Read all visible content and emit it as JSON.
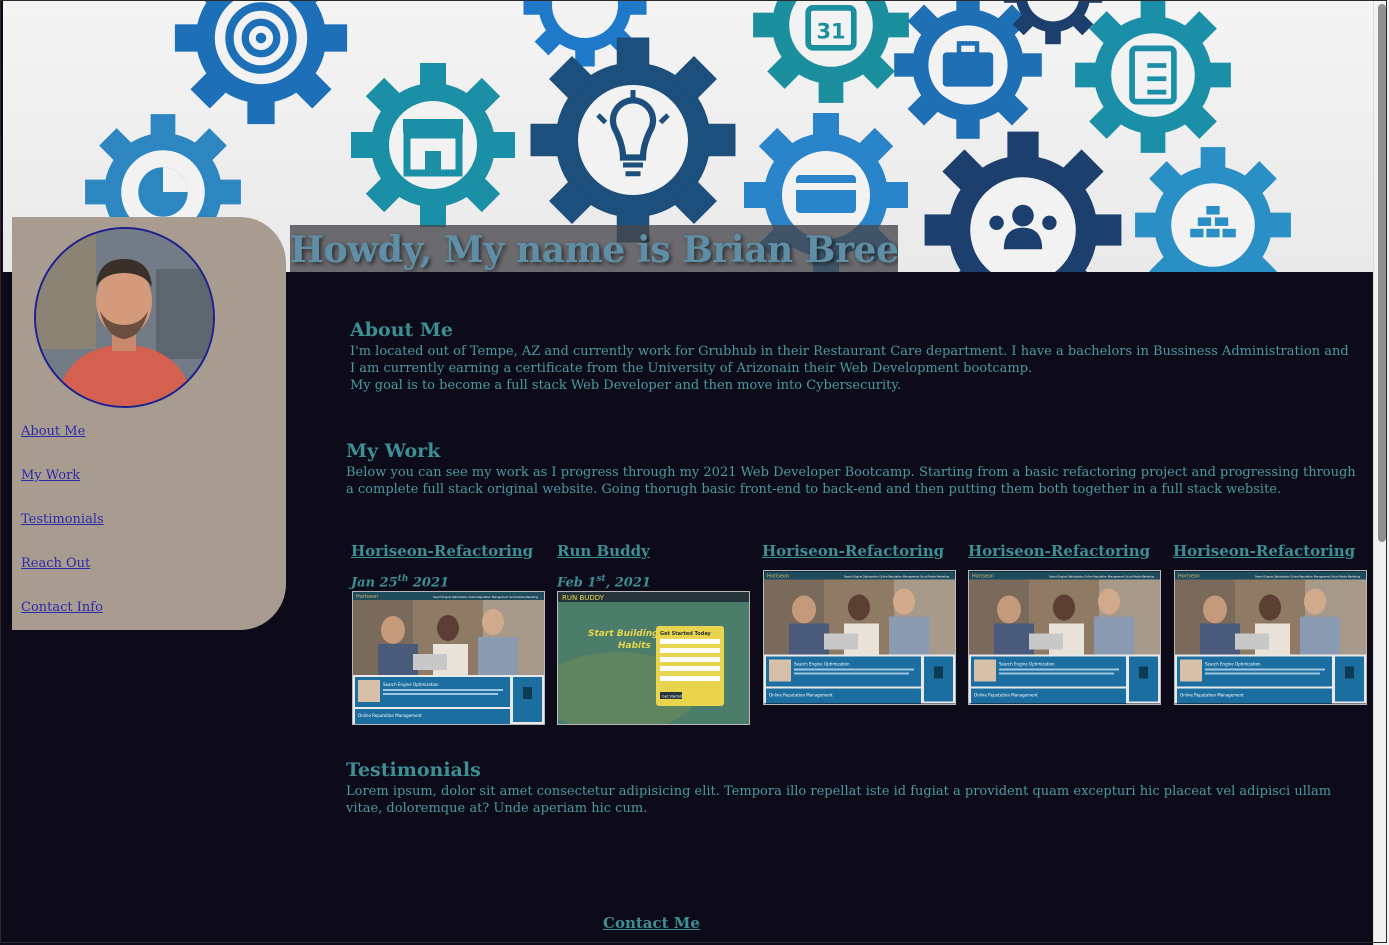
{
  "header": {
    "headline": "Howdy, My name is Brian Breedlove",
    "calendar_day": "31"
  },
  "sidebar": {
    "nav": [
      {
        "label": "About Me"
      },
      {
        "label": "My Work"
      },
      {
        "label": "Testimonials"
      },
      {
        "label": "Reach Out"
      },
      {
        "label": "Contact Info"
      }
    ]
  },
  "about": {
    "title": "About Me",
    "line1": "I'm located out of Tempe, AZ and currently work for Grubhub in their Restaurant Care department. I have a bachelors in Bussiness Administration and I am currently earning a certificate from the University of Arizonain their Web Development bootcamp.",
    "line2": "My goal is to become a full stack Web Developer and then move into Cybersecurity."
  },
  "work": {
    "title": "My Work",
    "body": "Below you can see my work as I progress through my 2021 Web Developer Bootcamp. Starting from a basic refactoring project and progressing through a complete full stack original website. Going thorugh basic front-end to back-end and then putting them both together in a full stack website.",
    "projects": [
      {
        "title": "Horiseon-Refactoring",
        "date_prefix": "Jan 25",
        "date_sup": "th",
        "date_suffix": " 2021"
      },
      {
        "title": "Run Buddy",
        "date_prefix": "Feb 1",
        "date_sup": "st",
        "date_suffix": ", 2021"
      },
      {
        "title": "Horiseon-Refactoring"
      },
      {
        "title": "Horiseon-Refactoring"
      },
      {
        "title": "Horiseon-Refactoring"
      }
    ],
    "thumb_text": {
      "horiseon_brand": "Horiseon",
      "horiseon_nav": "Search Engine Optimization  Online Reputation Management  Social Media Marketing",
      "horiseon_seo": "Search Engine Optimization",
      "horiseon_orm": "Online Reputation Management",
      "runbuddy_brand": "RUN BUDDY",
      "runbuddy_headline_1": "Start Building",
      "runbuddy_headline_2": "Habits",
      "runbuddy_form_title": "Get Started Today",
      "runbuddy_submit": "Get Started"
    }
  },
  "testimonials": {
    "title": "Testimonials",
    "body": "Lorem ipsum, dolor sit amet consectetur adipisicing elit. Tempora illo repellat iste id fugiat a provident quam excepturi hic placeat vel adipisci ullam vitae, doloremque at? Unde aperiam hic cum."
  },
  "footer": {
    "contact": "Contact Me"
  }
}
